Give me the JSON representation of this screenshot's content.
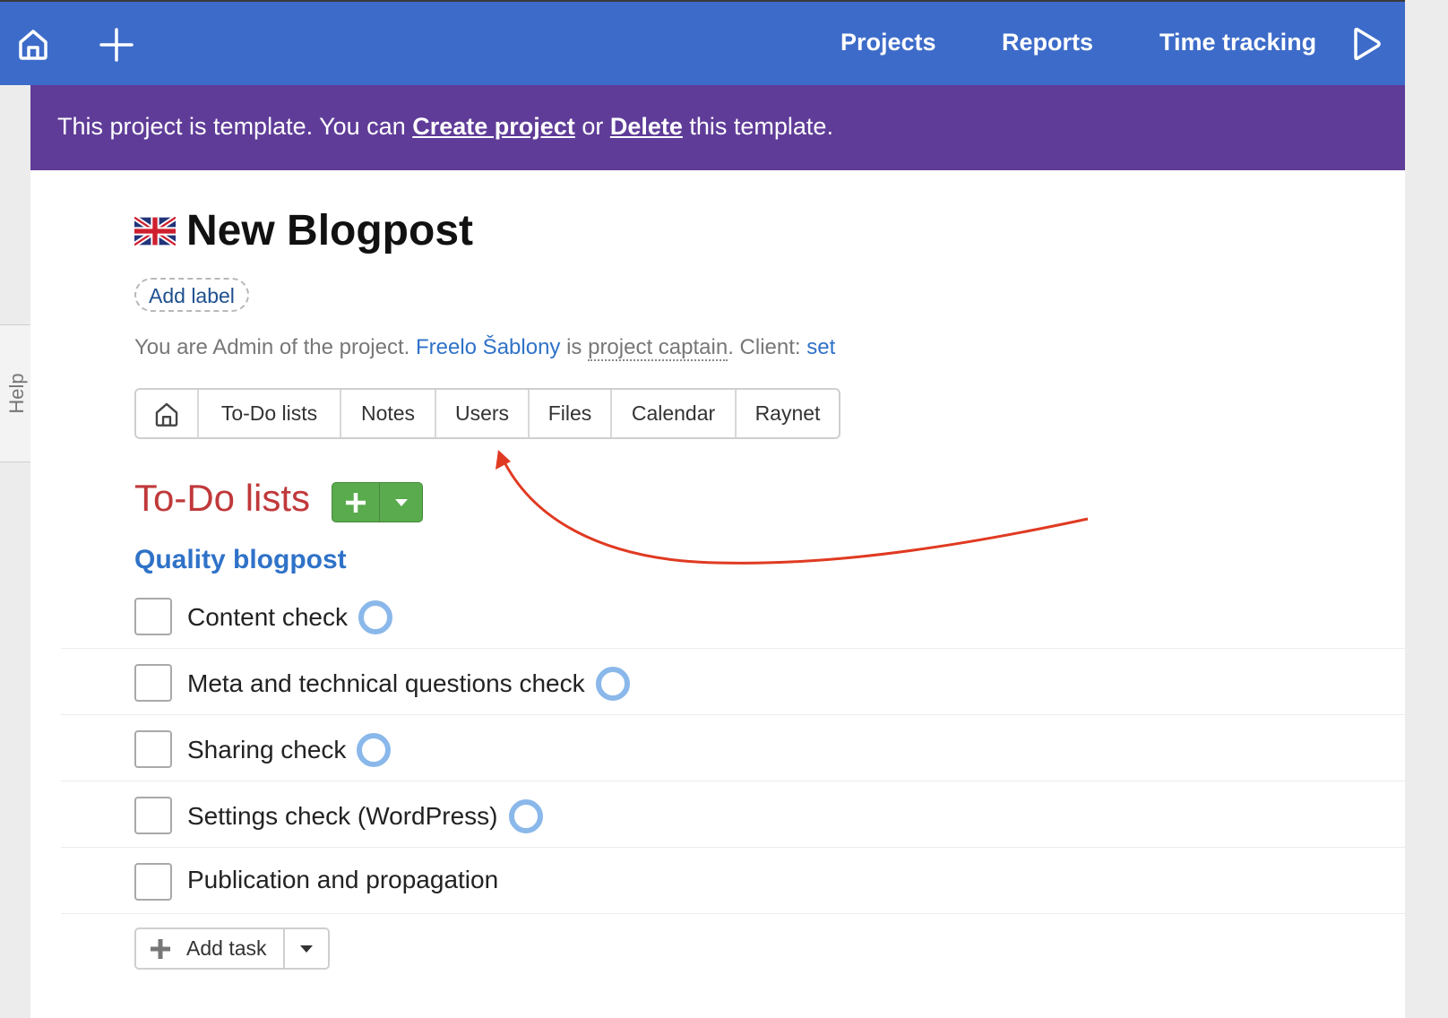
{
  "topbar": {
    "color": "#3d6bc9",
    "home_icon": "home-icon",
    "add_icon": "plus-icon",
    "nav": [
      "Projects",
      "Reports",
      "Time tracking"
    ],
    "play_icon": "play-icon"
  },
  "banner": {
    "color": "#5f3c98",
    "text_before": "This project is template. You can ",
    "create_link": "Create project",
    "middle": " or ",
    "delete_link": "Delete",
    "text_after": " this template."
  },
  "help": {
    "label": "Help"
  },
  "project": {
    "flag_icon": "uk-flag-icon",
    "title": "New Blogpost",
    "add_label": "Add label",
    "info": {
      "prefix": "You are Admin of the project. ",
      "captain": "Freelo Šablony",
      "is": " is ",
      "role": "project captain",
      "client_prefix": ". Client: ",
      "client_link": "set"
    }
  },
  "tabs": {
    "home_icon": "home-icon",
    "items": [
      "To-Do lists",
      "Notes",
      "Users",
      "Files",
      "Calendar",
      "Raynet"
    ]
  },
  "todo": {
    "section_title": "To-Do lists",
    "section_color": "#c0393b",
    "add_button_color": "#5aaa4e",
    "list_title": "Quality blogpost",
    "tasks": [
      {
        "label": "Content check",
        "has_ring": true
      },
      {
        "label": "Meta and technical questions check",
        "has_ring": true
      },
      {
        "label": "Sharing check",
        "has_ring": true
      },
      {
        "label": "Settings check (WordPress)",
        "has_ring": true
      },
      {
        "label": "Publication and propagation",
        "has_ring": false
      }
    ],
    "add_task_label": "Add task"
  },
  "annotation": {
    "arrow_color": "#e03a22"
  }
}
